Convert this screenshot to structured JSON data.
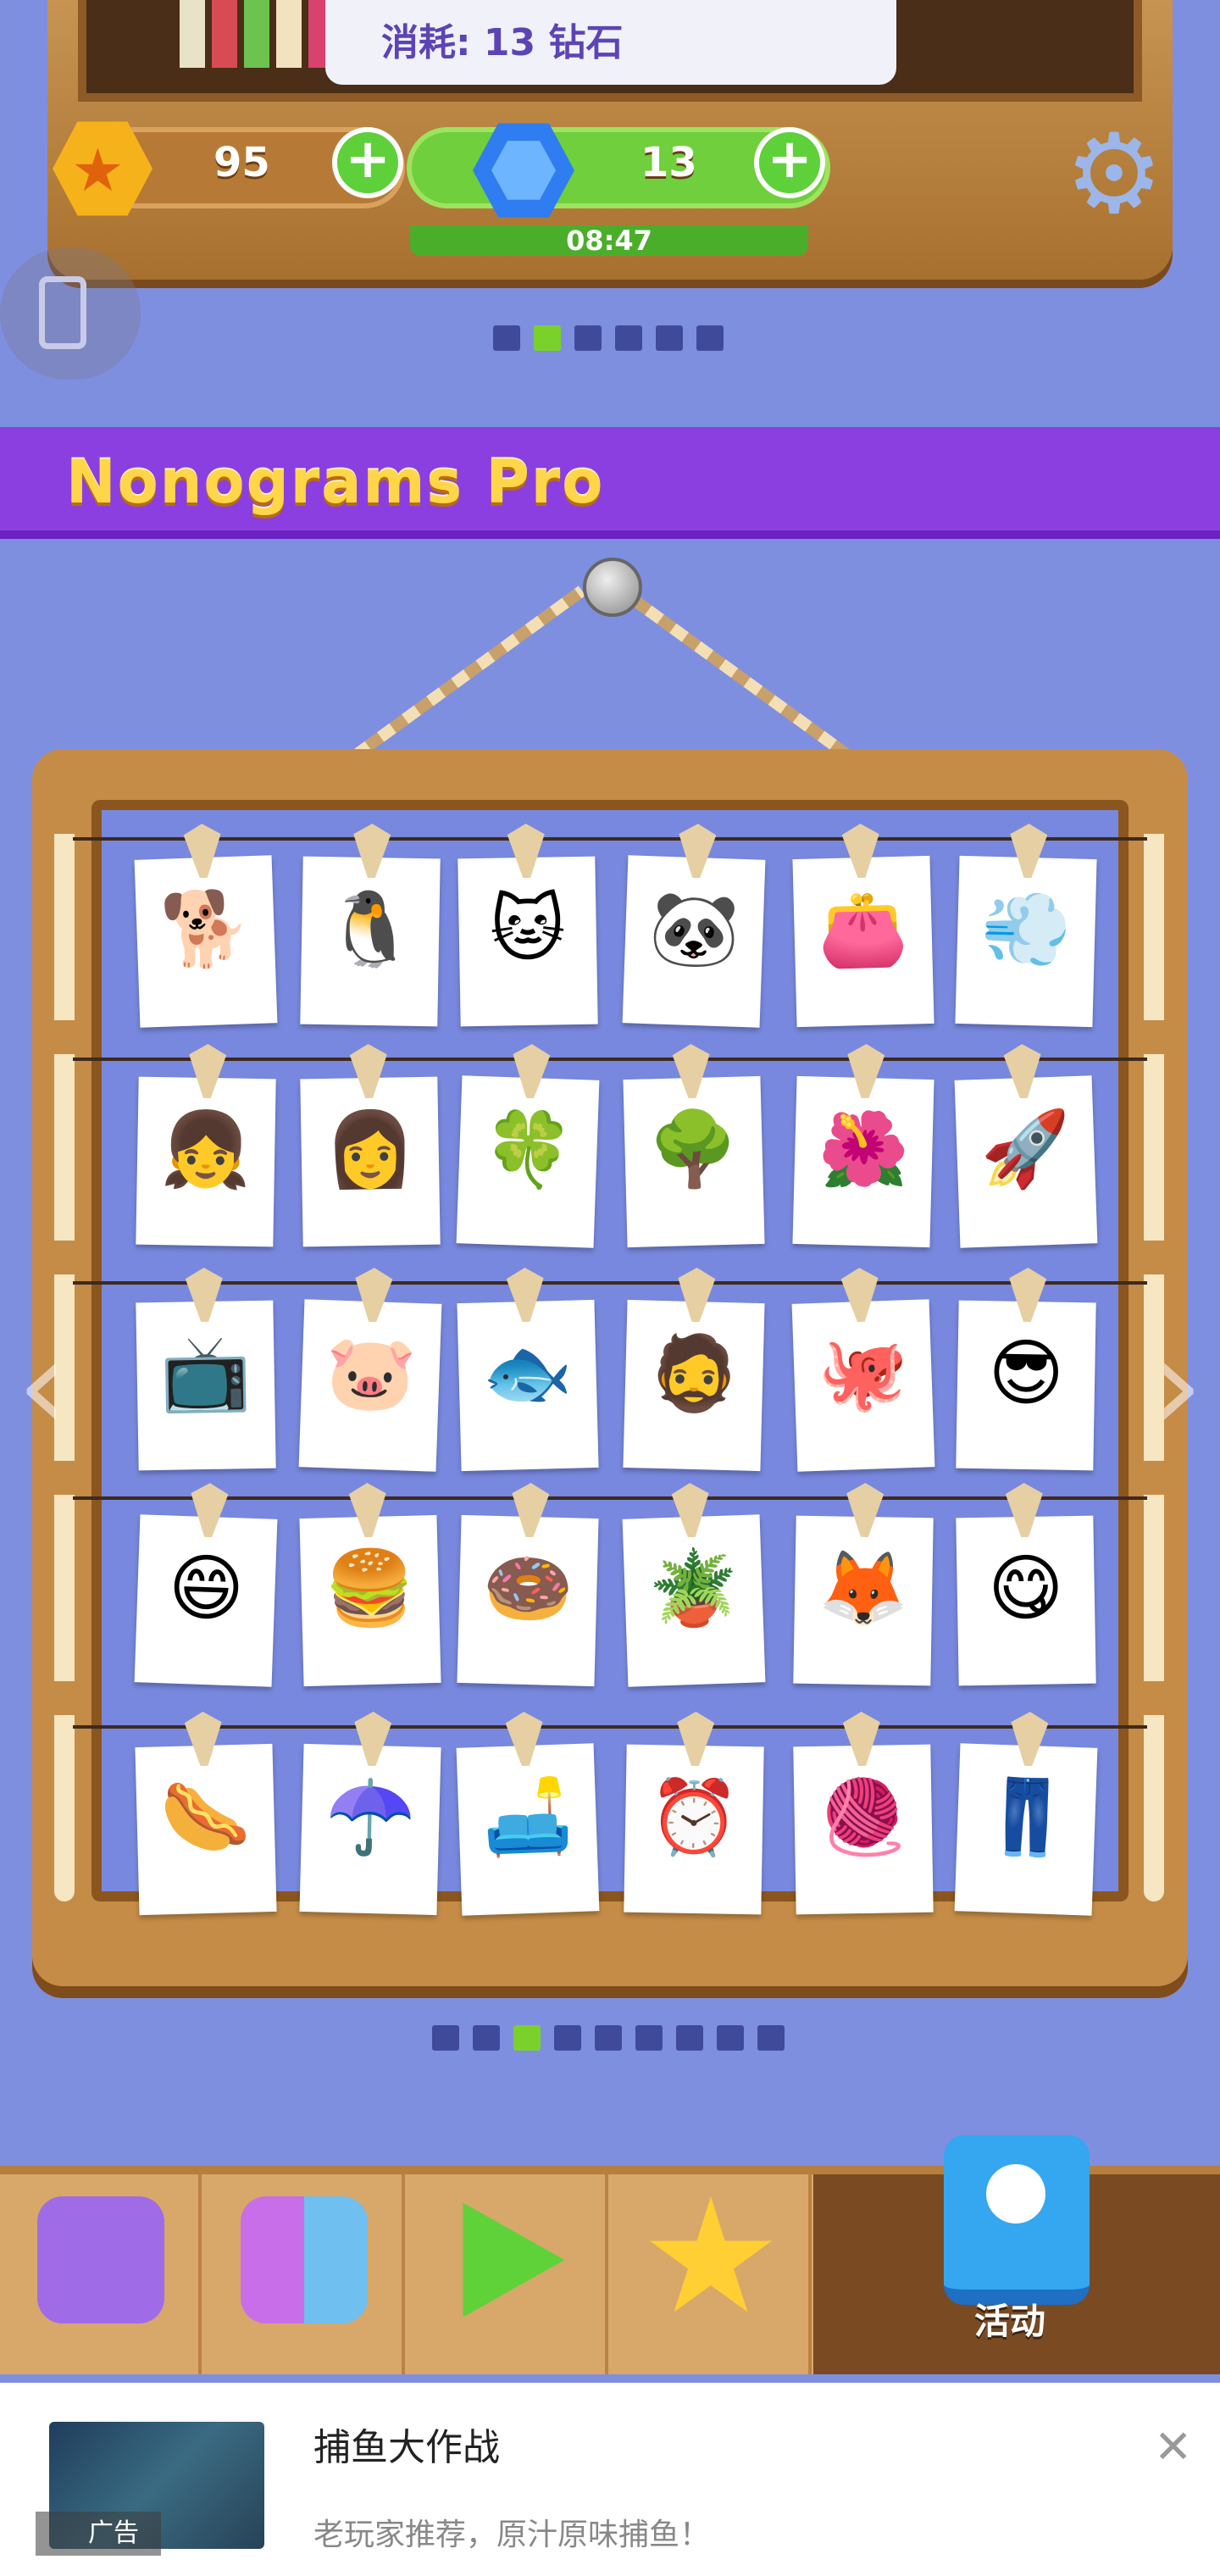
{
  "header": {
    "consume_text": "消耗: 13 钻石",
    "coins": "95",
    "gems": "13",
    "timer": "08:47",
    "plus_label": "+"
  },
  "pager_top": {
    "count": 6,
    "active_index": 1
  },
  "title": "Nonograms Pro",
  "puzzles": [
    [
      "🐕",
      "🐧",
      "🐱",
      "🐼",
      "👛",
      "💨"
    ],
    [
      "👧",
      "👩",
      "🍀",
      "🌳",
      "🌺",
      "🚀"
    ],
    [
      "📺",
      "🐷",
      "🐟",
      "🧔",
      "🐙",
      "😎"
    ],
    [
      "😄",
      "🍔",
      "🍩",
      "🪴",
      "🦊",
      "😋"
    ],
    [
      "🌭",
      "☂️",
      "🛋️",
      "⏰",
      "🧶",
      "👖"
    ]
  ],
  "puzzle_names": [
    [
      "dog",
      "penguin",
      "cat",
      "panda",
      "purse",
      "hair-dryer"
    ],
    [
      "girl-blonde",
      "girl-brown",
      "clover",
      "tree",
      "flower",
      "rocket"
    ],
    [
      "tv",
      "pig",
      "fish",
      "viking",
      "octopus",
      "sunglasses-emoji"
    ],
    [
      "laughing-emoji",
      "burger",
      "donut",
      "potted-plant",
      "fox",
      "yum-emoji"
    ],
    [
      "hotdog",
      "umbrella",
      "armchair",
      "alarm-clock",
      "sweater",
      "jeans"
    ]
  ],
  "pager_bottom": {
    "count": 9,
    "active_index": 2
  },
  "nav": {
    "items": [
      "shop-bag-icon",
      "puzzle-icon",
      "play-icon",
      "star-ribbon-icon"
    ],
    "active_label": "活动"
  },
  "ad": {
    "title": "捕鱼大作战",
    "description": "老玩家推荐，原汁原味捕鱼！",
    "tag": "广告",
    "close": "✕"
  },
  "colors": {
    "background": "#7f8fe0",
    "banner": "#8b3fe0",
    "title_text": "#ffd64a",
    "wood": "#c58c47",
    "active_dot": "#7bd12c"
  }
}
